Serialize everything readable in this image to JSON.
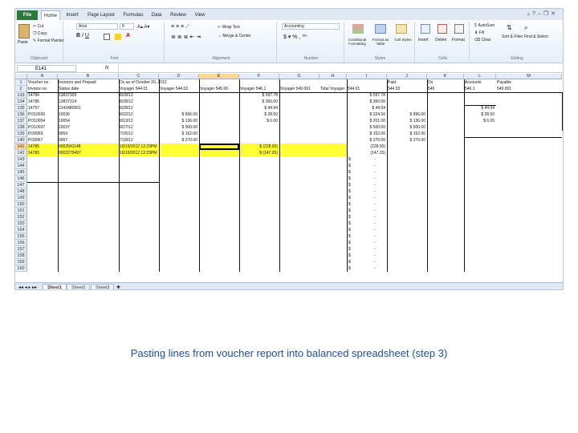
{
  "ribbon": {
    "tabs": [
      "File",
      "Home",
      "Insert",
      "Page Layout",
      "Formulas",
      "Data",
      "Review",
      "View"
    ],
    "clipboard": {
      "paste": "Paste",
      "cut": "Cut",
      "copy": "Copy",
      "format_painter": "Format Painter",
      "label": "Clipboard"
    },
    "font": {
      "name": "Arial",
      "size": "8",
      "label": "Font"
    },
    "alignment": {
      "wrap_text": "Wrap Text",
      "merge_center": "Merge & Center",
      "label": "Alignment"
    },
    "number": {
      "format": "Accounting",
      "label": "Number"
    },
    "styles": {
      "conditional": "Conditional Formatting",
      "format_table": "Format as Table",
      "cell_styles": "Cell Styles",
      "label": "Styles"
    },
    "cells": {
      "insert": "Insert",
      "delete": "Delete",
      "format": "Format",
      "label": "Cells"
    },
    "editing": {
      "autosum": "AutoSum",
      "fill": "Fill",
      "clear": "Clear",
      "sort_filter": "Sort & Filter",
      "find_select": "Find & Select",
      "label": "Editing"
    }
  },
  "formula_bar": {
    "name_box": "E141",
    "fx": "fx"
  },
  "grid": {
    "columns": [
      "A",
      "B",
      "C",
      "D",
      "E",
      "F",
      "G",
      "H",
      "I",
      "J",
      "K",
      "L",
      "M"
    ],
    "selected_column": "E",
    "selected_row": "141",
    "header_row1": [
      "Voucher no",
      "Invoices and Prepaid",
      "Os as of October 20, 2012",
      "",
      "",
      "",
      "",
      "",
      "",
      "Paid",
      "Os",
      "Accounts",
      "Payable"
    ],
    "header_row2": [
      "",
      "Invoice no.",
      "Status date",
      "Voyager 544.01",
      "Voyager 544.03",
      "Voyager 545.00",
      "Voyager 546.1",
      "Voyager 549.001",
      "Total Voyager",
      "544.01",
      "544.03",
      "545",
      "546.1",
      "549.001"
    ],
    "rows": [
      {
        "n": "133",
        "a": "14784",
        "b": "13837305",
        "c": "8/28/12",
        "d": "",
        "f": "$ 597.78",
        "i": "$ 597.78",
        "j": "",
        "k": "",
        "l": ""
      },
      {
        "n": "134",
        "a": "14786",
        "b": "13837314",
        "c": "8/28/12",
        "d": "",
        "f": "$ 360.00",
        "i": "$ 360.00",
        "j": "",
        "k": "",
        "l": ""
      },
      {
        "n": "135",
        "a": "14757",
        "b": "2143480001",
        "c": "8/28/12",
        "d": "",
        "f": "$ 44.94",
        "i": "$ 44.94",
        "j": "",
        "k": "",
        "l": "$ 44.94"
      },
      {
        "n": "136",
        "a": "PO10036",
        "b": "10036",
        "c": "8/22/12",
        "d": "$ 896.00",
        "f": "$ 28.50",
        "i": "$ 224.50",
        "j": "$ 896.00",
        "k": "",
        "l": "$ 28.50"
      },
      {
        "n": "137",
        "a": "PO10054",
        "b": "10054",
        "c": "8/13/12",
        "d": "$ 136.00",
        "f": "$ 6.00",
        "i": "$ 201.00",
        "j": "$ 136.00",
        "k": "",
        "l": "$ 6.00"
      },
      {
        "n": "138",
        "a": "PO10037",
        "b": "10037",
        "c": "8/27/12",
        "d": "$ 500.00",
        "f": "",
        "i": "$ 500.00",
        "j": "$ 500.00",
        "k": "",
        "l": ""
      },
      {
        "n": "139",
        "a": "PO9959",
        "b": "9959",
        "c": "7/26/12",
        "d": "$ 152.00",
        "f": "",
        "i": "$ 152.00",
        "j": "$ 152.00",
        "k": "",
        "l": ""
      },
      {
        "n": "140",
        "a": "PO9967",
        "b": "9967",
        "c": "7/18/12",
        "d": "$ 270.00",
        "f": "",
        "i": "$ 270.00",
        "j": "$ 270.00",
        "k": "",
        "l": ""
      },
      {
        "n": "141",
        "a": "14785",
        "b": "0002541148",
        "c": "10/19/2012 12:23PM",
        "d": "",
        "f": "$ (228.00)",
        "i": "(228.00)",
        "j": "",
        "k": "",
        "l": ""
      },
      {
        "n": "142",
        "a": "14783",
        "b": "0002279497",
        "c": "10/19/2012 12:23PM",
        "d": "",
        "f": "$ (147.25)",
        "i": "(147.25)",
        "j": "",
        "k": "",
        "l": ""
      }
    ],
    "empty_rows": [
      "143",
      "144",
      "145",
      "146",
      "147",
      "148",
      "149",
      "150",
      "151",
      "152",
      "153",
      "154",
      "155",
      "156",
      "157",
      "158",
      "159",
      "160"
    ],
    "dash_symbol": "$",
    "dash_value": "-"
  },
  "sheet_tabs": [
    "Sheet1",
    "Sheet2",
    "Sheet3"
  ],
  "caption": "Pasting lines from voucher report into balanced spreadsheet (step 3)",
  "colors": {
    "highlight": "#ffff33",
    "caption": "#1f4e9a",
    "file_tab": "#2a7a3a",
    "selected_header": "#f9d98a"
  }
}
